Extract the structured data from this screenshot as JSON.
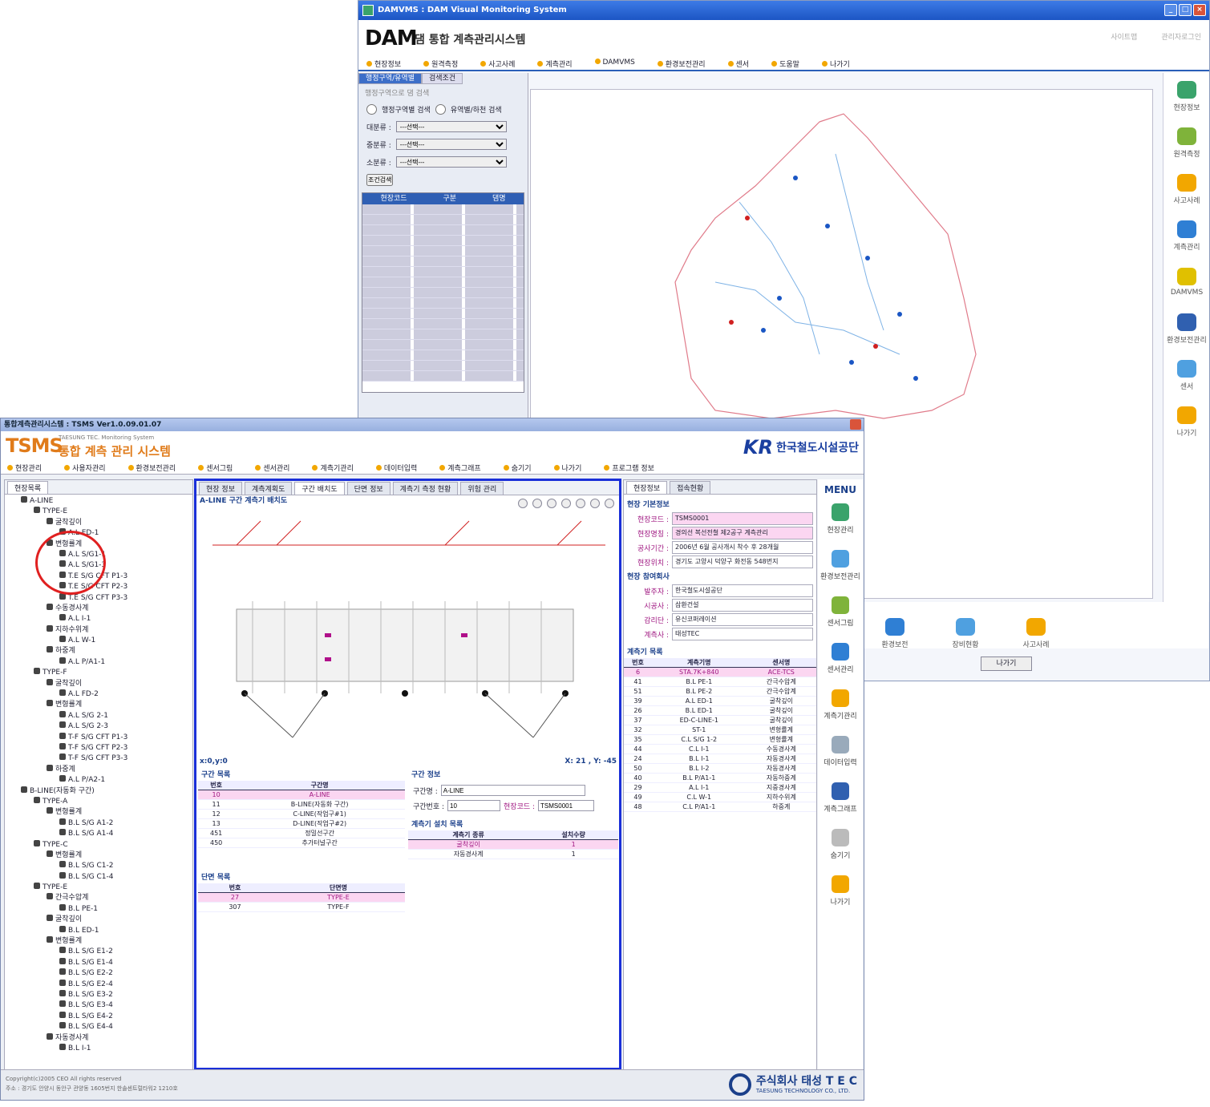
{
  "dam": {
    "title": "DAMVMS : DAM Visual Monitoring System",
    "logo": "DAM",
    "logo_sub": "댐 통합 계측관리시스템",
    "top_links": [
      "사이트맵",
      "관리자로그인"
    ],
    "menu": [
      "현장정보",
      "원격측정",
      "사고사례",
      "계측관리",
      "DAMVMS",
      "환경보전관리",
      "센서",
      "도움말",
      "나가기"
    ],
    "left_tabs": [
      "행정구역/유역별",
      "검색조건"
    ],
    "left_title": "행정구역으로 댐 검색",
    "radio": [
      "행정구역별 검색",
      "유역별/하천 검색"
    ],
    "filters": [
      {
        "label": "대분류 :",
        "value": "---선택---"
      },
      {
        "label": "중분류 :",
        "value": "---선택---"
      },
      {
        "label": "소분류 :",
        "value": "---선택---"
      }
    ],
    "search_btn": "조건검색",
    "result_head": [
      "현장코드",
      "구분",
      "댐명"
    ],
    "right_menu": [
      "현장정보",
      "원격측정",
      "사고사례",
      "계측관리",
      "DAMVMS",
      "환경보전관리",
      "센서",
      "나가기"
    ],
    "bottom": [
      "환경보전",
      "장비현황",
      "사고사례"
    ],
    "exit": "나가기"
  },
  "tsms": {
    "title": "통합계측관리시스템 : TSMS Ver1.0.09.01.07",
    "logo": "TSMS",
    "logo_sub": "TAESUNG TEC. Monitoring System",
    "logo_title": "통합 계측 관리 시스템",
    "org": "한국철도시설공단",
    "org_logo": "KR",
    "menu": [
      "현장관리",
      "사용자관리",
      "환경보전관리",
      "센서그림",
      "센서관리",
      "계측기관리",
      "데이터입력",
      "계측그래프",
      "숨기기",
      "나가기",
      "프로그램 정보"
    ],
    "tree_tab": "현장목록",
    "tree": [
      {
        "t": "A-LINE",
        "d": 1
      },
      {
        "t": "TYPE-E",
        "d": 2
      },
      {
        "t": "굴착깊이",
        "d": 3
      },
      {
        "t": "A.L ED-1",
        "d": 4
      },
      {
        "t": "변형률계",
        "d": 3
      },
      {
        "t": "A.L S/G1-1",
        "d": 4
      },
      {
        "t": "A.L S/G1-3",
        "d": 4
      },
      {
        "t": "T.E S/G CFT P1-3",
        "d": 4
      },
      {
        "t": "T.E S/G CFT P2-3",
        "d": 4
      },
      {
        "t": "T.E S/G CFT P3-3",
        "d": 4
      },
      {
        "t": "수동경사계",
        "d": 3
      },
      {
        "t": "A.L I-1",
        "d": 4
      },
      {
        "t": "지하수위계",
        "d": 3
      },
      {
        "t": "A.L W-1",
        "d": 4
      },
      {
        "t": "하중계",
        "d": 3
      },
      {
        "t": "A.L P/A1-1",
        "d": 4
      },
      {
        "t": "TYPE-F",
        "d": 2
      },
      {
        "t": "굴착깊이",
        "d": 3
      },
      {
        "t": "A.L FD-2",
        "d": 4
      },
      {
        "t": "변형률계",
        "d": 3
      },
      {
        "t": "A.L S/G 2-1",
        "d": 4
      },
      {
        "t": "A.L S/G 2-3",
        "d": 4
      },
      {
        "t": "T-F S/G CFT P1-3",
        "d": 4
      },
      {
        "t": "T-F S/G CFT P2-3",
        "d": 4
      },
      {
        "t": "T-F S/G CFT P3-3",
        "d": 4
      },
      {
        "t": "하중계",
        "d": 3
      },
      {
        "t": "A.L P/A2-1",
        "d": 4
      },
      {
        "t": "B-LINE(자동화 구간)",
        "d": 1
      },
      {
        "t": "TYPE-A",
        "d": 2
      },
      {
        "t": "변형률계",
        "d": 3
      },
      {
        "t": "B.L S/G A1-2",
        "d": 4
      },
      {
        "t": "B.L S/G A1-4",
        "d": 4
      },
      {
        "t": "TYPE-C",
        "d": 2
      },
      {
        "t": "변형률계",
        "d": 3
      },
      {
        "t": "B.L S/G C1-2",
        "d": 4
      },
      {
        "t": "B.L S/G C1-4",
        "d": 4
      },
      {
        "t": "TYPE-E",
        "d": 2
      },
      {
        "t": "간극수압계",
        "d": 3
      },
      {
        "t": "B.L PE-1",
        "d": 4
      },
      {
        "t": "굴착깊이",
        "d": 3
      },
      {
        "t": "B.L ED-1",
        "d": 4
      },
      {
        "t": "변형률계",
        "d": 3
      },
      {
        "t": "B.L S/G E1-2",
        "d": 4
      },
      {
        "t": "B.L S/G E1-4",
        "d": 4
      },
      {
        "t": "B.L S/G E2-2",
        "d": 4
      },
      {
        "t": "B.L S/G E2-4",
        "d": 4
      },
      {
        "t": "B.L S/G E3-2",
        "d": 4
      },
      {
        "t": "B.L S/G E3-4",
        "d": 4
      },
      {
        "t": "B.L S/G E4-2",
        "d": 4
      },
      {
        "t": "B.L S/G E4-4",
        "d": 4
      },
      {
        "t": "자동경사계",
        "d": 3
      },
      {
        "t": "B.L I-1",
        "d": 4
      }
    ],
    "center_tabs": [
      "현장 정보",
      "계측계획도",
      "구간 배치도",
      "단면 정보",
      "계측기 측정 현황",
      "위험 관리"
    ],
    "drawing_title": "A-LINE 구간 계측기 배치도",
    "coord_left": "x:0,y:0",
    "coord_right": "X: 21 , Y: -45",
    "section_list_title": "구간 목록",
    "section_list_head": [
      "번호",
      "구간명"
    ],
    "section_list": [
      [
        "10",
        "A-LINE"
      ],
      [
        "11",
        "B-LINE(자동화 구간)"
      ],
      [
        "12",
        "C-LINE(작업구#1)"
      ],
      [
        "13",
        "D-LINE(작업구#2)"
      ],
      [
        "451",
        "정밀선구간"
      ],
      [
        "450",
        "추가터널구간"
      ]
    ],
    "section_info_title": "구간 정보",
    "sec_name_label": "구간명 :",
    "sec_name": "A-LINE",
    "sec_no_label": "구간번호 :",
    "sec_no": "10",
    "site_code_label": "현장코드 :",
    "site_code": "TSMS0001",
    "install_title": "계측기 설치 목록",
    "install_head": [
      "계측기 종류",
      "설치수량"
    ],
    "install": [
      [
        "굴착깊이",
        "1"
      ],
      [
        "자동경사계",
        "1"
      ]
    ],
    "cross_title": "단면 목록",
    "cross_head": [
      "번호",
      "단면명"
    ],
    "cross": [
      [
        "27",
        "TYPE-E"
      ],
      [
        "307",
        "TYPE-F"
      ]
    ],
    "right_tabs": [
      "현장정보",
      "접속현황"
    ],
    "basic_title": "현장 기본정보",
    "basic": [
      {
        "k": "현장코드 :",
        "v": "TSMS0001",
        "pink": true
      },
      {
        "k": "현장명칭 :",
        "v": "경의선 복선전철 제2공구 계측관리",
        "pink": true
      },
      {
        "k": "공사기간 :",
        "v": "2006년 6월 공사개시 착수 후 28개월"
      },
      {
        "k": "현장위치 :",
        "v": "경기도 고양시 덕양구 화전동 548번지"
      }
    ],
    "company_title": "현장 참여회사",
    "company": [
      {
        "k": "발주자 :",
        "v": "한국철도시설공단"
      },
      {
        "k": "시공사 :",
        "v": "삼환건설"
      },
      {
        "k": "감리단 :",
        "v": "유신코퍼레이션"
      },
      {
        "k": "계측사 :",
        "v": "태성TEC"
      }
    ],
    "inst_title": "계측기 목록",
    "inst_head": [
      "번호",
      "계측기명",
      "센서명"
    ],
    "inst": [
      [
        "6",
        "STA.7K+840",
        "ACE-TCS"
      ],
      [
        "41",
        "B.L PE-1",
        "간극수압계"
      ],
      [
        "51",
        "B.L PE-2",
        "간극수압계"
      ],
      [
        "39",
        "A.L ED-1",
        "굴착깊이"
      ],
      [
        "26",
        "B.L ED-1",
        "굴착깊이"
      ],
      [
        "37",
        "ED-C-LINE-1",
        "굴착깊이"
      ],
      [
        "32",
        "ST-1",
        "변형률계"
      ],
      [
        "35",
        "C.L S/G 1-2",
        "변형률계"
      ],
      [
        "44",
        "C.L I-1",
        "수동경사계"
      ],
      [
        "24",
        "B.L I-1",
        "자동경사계"
      ],
      [
        "50",
        "B.L I-2",
        "자동경사계"
      ],
      [
        "40",
        "B.L P/A1-1",
        "자동하중계"
      ],
      [
        "29",
        "A.L I-1",
        "지중경사계"
      ],
      [
        "49",
        "C.L W-1",
        "지하수위계"
      ],
      [
        "48",
        "C.L P/A1-1",
        "하중계"
      ]
    ],
    "menu_title": "MENU",
    "rmenu": [
      "현장관리",
      "환경보전관리",
      "센서그림",
      "센서관리",
      "계측기관리",
      "데이터입력",
      "계측그래프",
      "숨기기",
      "나가기"
    ],
    "copyright": "Copyright(c)2005 CEO All rights reserved",
    "address": "주소 : 경기도 안양시 동안구 관양동 1605번지 한솔센트럴타워2 1210호",
    "tec_name": "주식회사 태성 T E C",
    "tec_sub": "TAESUNG TECHNOLOGY CO., LTD."
  }
}
